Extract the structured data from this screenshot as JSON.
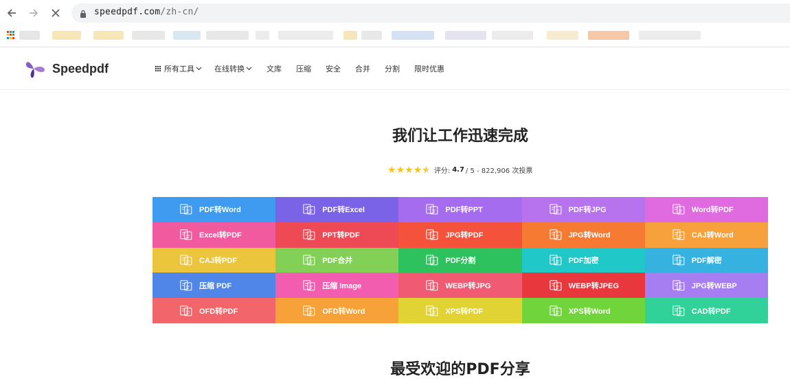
{
  "browser": {
    "url_domain": "speedpdf.com",
    "url_path": "/zh-cn/"
  },
  "site": {
    "logo_text": "Speedpdf",
    "brand_color": "#6a3fb5",
    "menu": [
      {
        "label": "所有工具",
        "dropdown": true,
        "grid_icon": true
      },
      {
        "label": "在线转换",
        "dropdown": true
      },
      {
        "label": "文库"
      },
      {
        "label": "压缩"
      },
      {
        "label": "安全"
      },
      {
        "label": "合并"
      },
      {
        "label": "分割"
      },
      {
        "label": "限时优惠"
      }
    ]
  },
  "hero": {
    "title": "我们让工作迅速完成",
    "rating_prefix": "评分:",
    "rating_value": "4.7",
    "rating_suffix": "/ 5 - 822,906 次投票",
    "stars": 4.5
  },
  "tools": [
    {
      "label": "PDF转Word",
      "color": "#3f9bef"
    },
    {
      "label": "PDF转Excel",
      "color": "#7b63e8"
    },
    {
      "label": "PDF转PPT",
      "color": "#a66cf0"
    },
    {
      "label": "PDF转JPG",
      "color": "#b773ee"
    },
    {
      "label": "Word转PDF",
      "color": "#e06be0"
    },
    {
      "label": "Excel转PDF",
      "color": "#f25aa0"
    },
    {
      "label": "PPT转PDF",
      "color": "#ee4a55"
    },
    {
      "label": "JPG转PDF",
      "color": "#f5523c"
    },
    {
      "label": "JPG转Word",
      "color": "#f77a32"
    },
    {
      "label": "CAJ转Word",
      "color": "#f7a13c"
    },
    {
      "label": "CAJ转PDF",
      "color": "#ebc53c"
    },
    {
      "label": "PDF合并",
      "color": "#82d055"
    },
    {
      "label": "PDF分割",
      "color": "#2ec25e"
    },
    {
      "label": "PDF加密",
      "color": "#20c8c8"
    },
    {
      "label": "PDF解密",
      "color": "#36b2e0"
    },
    {
      "label": "压缩 PDF",
      "color": "#4f86e8"
    },
    {
      "label": "压缩 Image",
      "color": "#f25db0"
    },
    {
      "label": "WEBP转JPG",
      "color": "#f05a72"
    },
    {
      "label": "WEBP转JPEG",
      "color": "#e8383e"
    },
    {
      "label": "JPG转WEBP",
      "color": "#a77ef2"
    },
    {
      "label": "OFD转PDF",
      "color": "#f2656a"
    },
    {
      "label": "OFD转Word",
      "color": "#f7a238"
    },
    {
      "label": "XPS转PDF",
      "color": "#e2d334"
    },
    {
      "label": "XPS转Word",
      "color": "#6fd53a"
    },
    {
      "label": "CAD转PDF",
      "color": "#30d29a"
    }
  ],
  "popular": {
    "title": "最受欢迎的PDF分享"
  }
}
